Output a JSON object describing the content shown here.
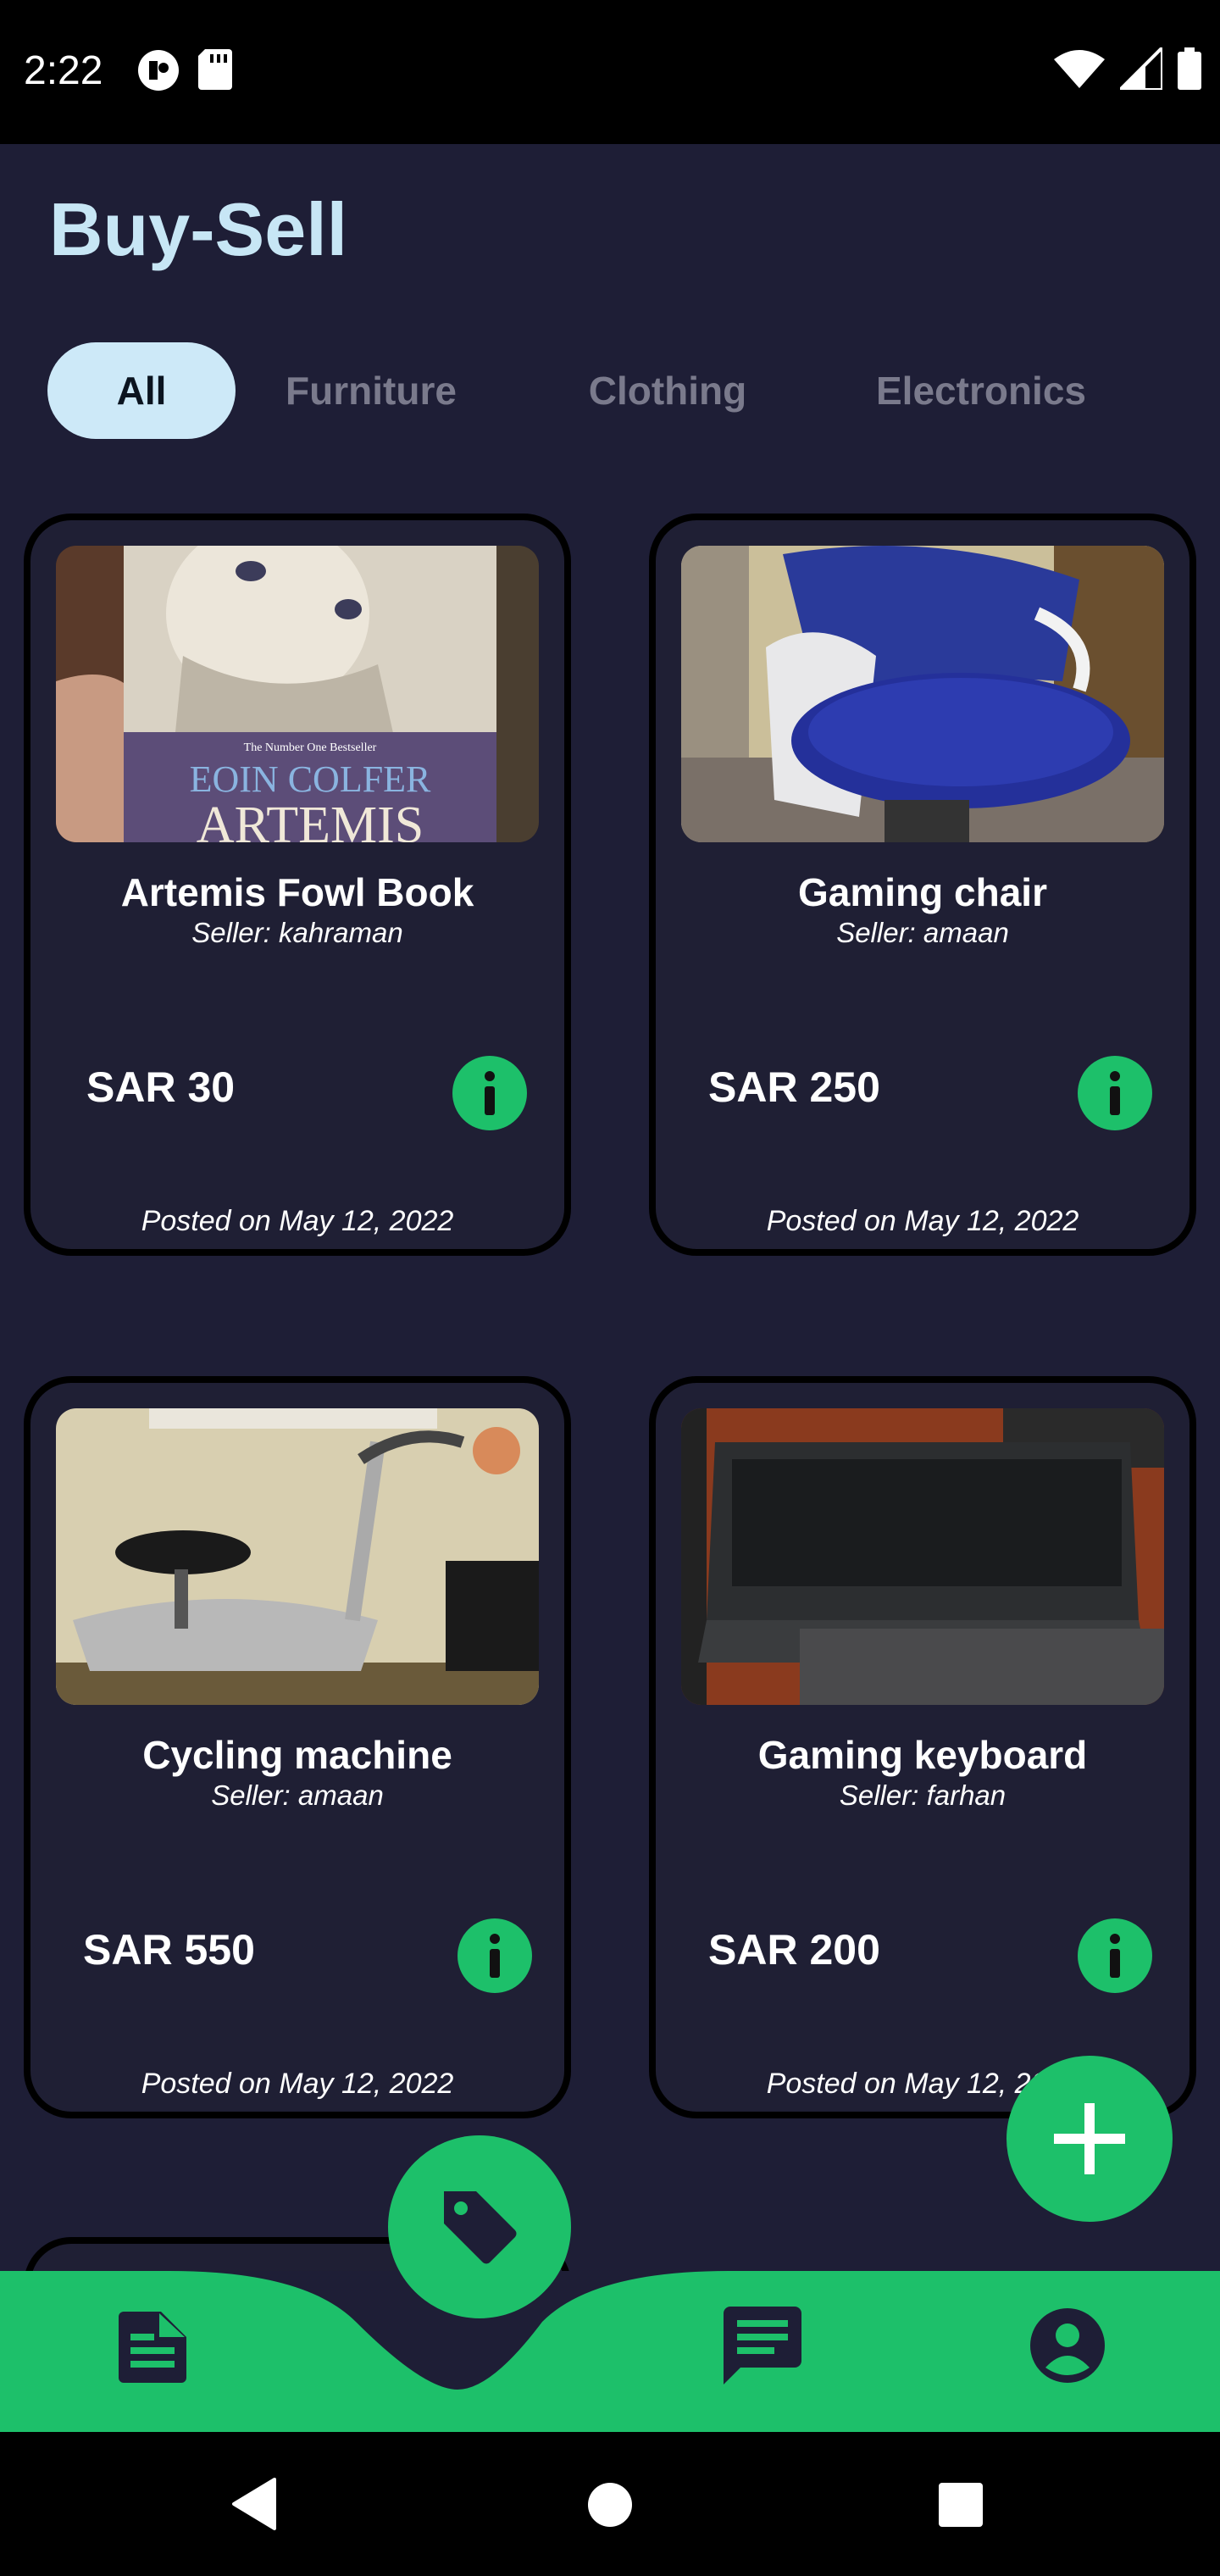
{
  "status": {
    "time": "2:22"
  },
  "app": {
    "title": "Buy-Sell"
  },
  "tabs": [
    {
      "label": "All",
      "active": true
    },
    {
      "label": "Furniture",
      "active": false
    },
    {
      "label": "Clothing",
      "active": false
    },
    {
      "label": "Electronics",
      "active": false
    }
  ],
  "listings": [
    {
      "title": "Artemis Fowl Book",
      "seller": "Seller: kahraman",
      "price": "SAR 30",
      "date": "Posted on May 12, 2022",
      "image": "book-cover-image"
    },
    {
      "title": "Gaming chair",
      "seller": "Seller: amaan",
      "price": "SAR 250",
      "date": "Posted on May 12, 2022",
      "image": "office-chair-image"
    },
    {
      "title": "Cycling machine",
      "seller": "Seller: amaan",
      "price": "SAR 550",
      "date": "Posted on May 12, 2022",
      "image": "exercise-bike-image"
    },
    {
      "title": "Gaming keyboard",
      "seller": "Seller: farhan",
      "price": "SAR 200",
      "date": "Posted on May 12, 2022",
      "image": "keyboard-image"
    }
  ],
  "book_cover": {
    "subtitle": "The Number One Bestseller",
    "author": "EOIN COLFER",
    "series": "ARTEMIS"
  },
  "colors": {
    "background": "#1e1e36",
    "accent": "#1dc06a",
    "title": "#c7e6f5",
    "active_tab": "#cde9f8"
  },
  "icons": {
    "fab": "plus-icon",
    "nav": [
      "document-icon",
      "tag-icon",
      "chat-icon",
      "account-icon"
    ]
  }
}
